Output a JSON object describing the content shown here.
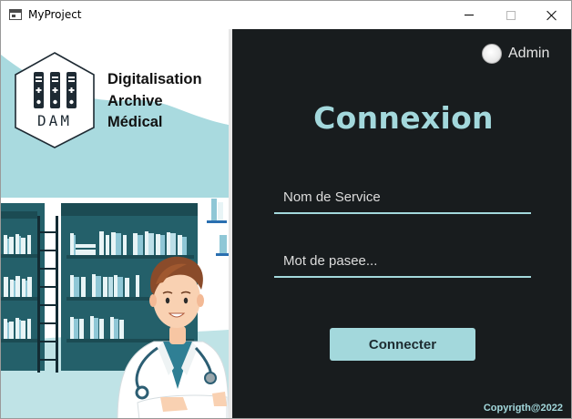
{
  "window": {
    "title": "MyProject"
  },
  "branding": {
    "logo_text": "DAM",
    "line1": "Digitalisation",
    "line2": "Archive",
    "line3": "Médical"
  },
  "login": {
    "admin_label": "Admin",
    "heading": "Connexion",
    "username_placeholder": "Nom de Service",
    "password_placeholder": "Mot de pasee...",
    "submit_label": "Connecter",
    "copyright": "Copyrigth@2022"
  },
  "colors": {
    "accent": "#a3d8dc",
    "dark_panel": "#181c1e",
    "shelf_teal": "#24606a",
    "wave_light": "#a9dadf"
  },
  "icons": {
    "app": "app-window-icon",
    "minimize": "minimize-icon",
    "maximize": "maximize-icon",
    "close": "close-icon",
    "logo": "archive-binders-logo",
    "admin_radio": "radio-button-icon"
  }
}
